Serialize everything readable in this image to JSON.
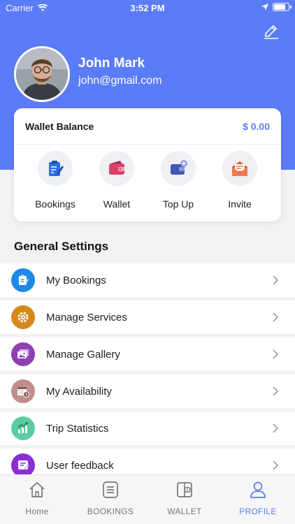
{
  "status": {
    "carrier": "Carrier",
    "time": "3:52 PM"
  },
  "profile": {
    "name": "John Mark",
    "email": "john@gmail.com"
  },
  "wallet_card": {
    "title": "Wallet Balance",
    "amount": "$ 0.00",
    "actions": [
      {
        "label": "Bookings",
        "icon": "clipboard-edit-icon",
        "color": "#2f6fe0"
      },
      {
        "label": "Wallet",
        "icon": "wallet-icon",
        "color": "#d9406a"
      },
      {
        "label": "Top Up",
        "icon": "wallet-plus-icon",
        "color": "#4456b8"
      },
      {
        "label": "Invite",
        "icon": "envelope-open-icon",
        "color": "#e8582c"
      }
    ]
  },
  "general_settings": {
    "title": "General Settings",
    "items": [
      {
        "label": "My Bookings",
        "icon": "clipboard-icon",
        "color": "#1e88e5"
      },
      {
        "label": "Manage Services",
        "icon": "gear-icon",
        "color": "#d4891a"
      },
      {
        "label": "Manage Gallery",
        "icon": "gallery-icon",
        "color": "#8e3fb0"
      },
      {
        "label": "My Availability",
        "icon": "calendar-clock-icon",
        "color": "#c08d8d"
      },
      {
        "label": "Trip Statistics",
        "icon": "chart-icon",
        "color": "#5ccca0"
      },
      {
        "label": "User feedback",
        "icon": "feedback-icon",
        "color": "#8a2fd1"
      }
    ]
  },
  "tabs": [
    {
      "label": "Home",
      "icon": "home-icon",
      "active": false
    },
    {
      "label": "BOOKINGS",
      "icon": "list-icon",
      "active": false
    },
    {
      "label": "WALLET",
      "icon": "wallet-icon",
      "active": false
    },
    {
      "label": "PROFILE",
      "icon": "person-icon",
      "active": true
    }
  ],
  "colors": {
    "accent": "#5b7cf7",
    "background": "#f2f2f4"
  }
}
